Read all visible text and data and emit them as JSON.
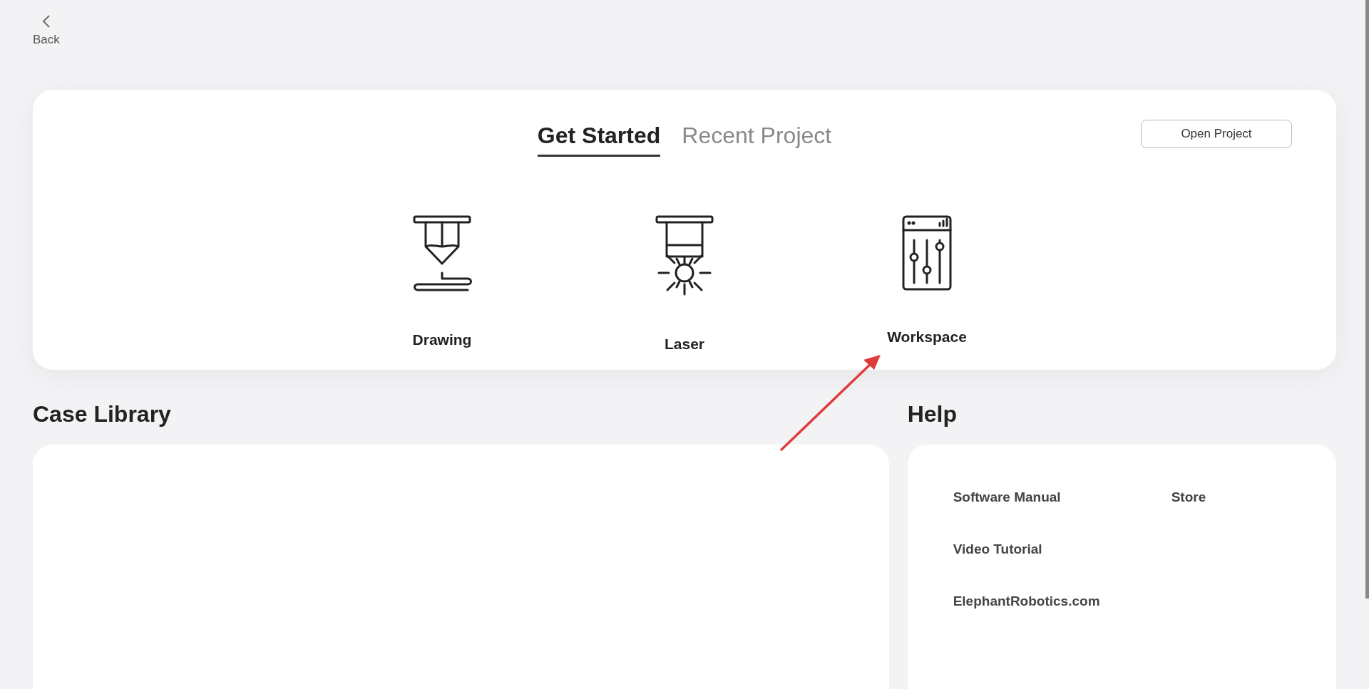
{
  "back": {
    "label": "Back"
  },
  "tabs": [
    {
      "label": "Get Started",
      "selected": true
    },
    {
      "label": "Recent Project",
      "selected": false
    }
  ],
  "open_project": {
    "label": "Open Project"
  },
  "modes": [
    {
      "kind": "drawing",
      "label": "Drawing"
    },
    {
      "kind": "laser",
      "label": "Laser"
    },
    {
      "kind": "workspace",
      "label": "Workspace"
    }
  ],
  "case_library": {
    "title": "Case Library"
  },
  "help": {
    "title": "Help",
    "rows": [
      [
        "Software Manual",
        "Store"
      ],
      [
        "Video Tutorial"
      ],
      [
        "ElephantRobotics.com"
      ]
    ]
  }
}
